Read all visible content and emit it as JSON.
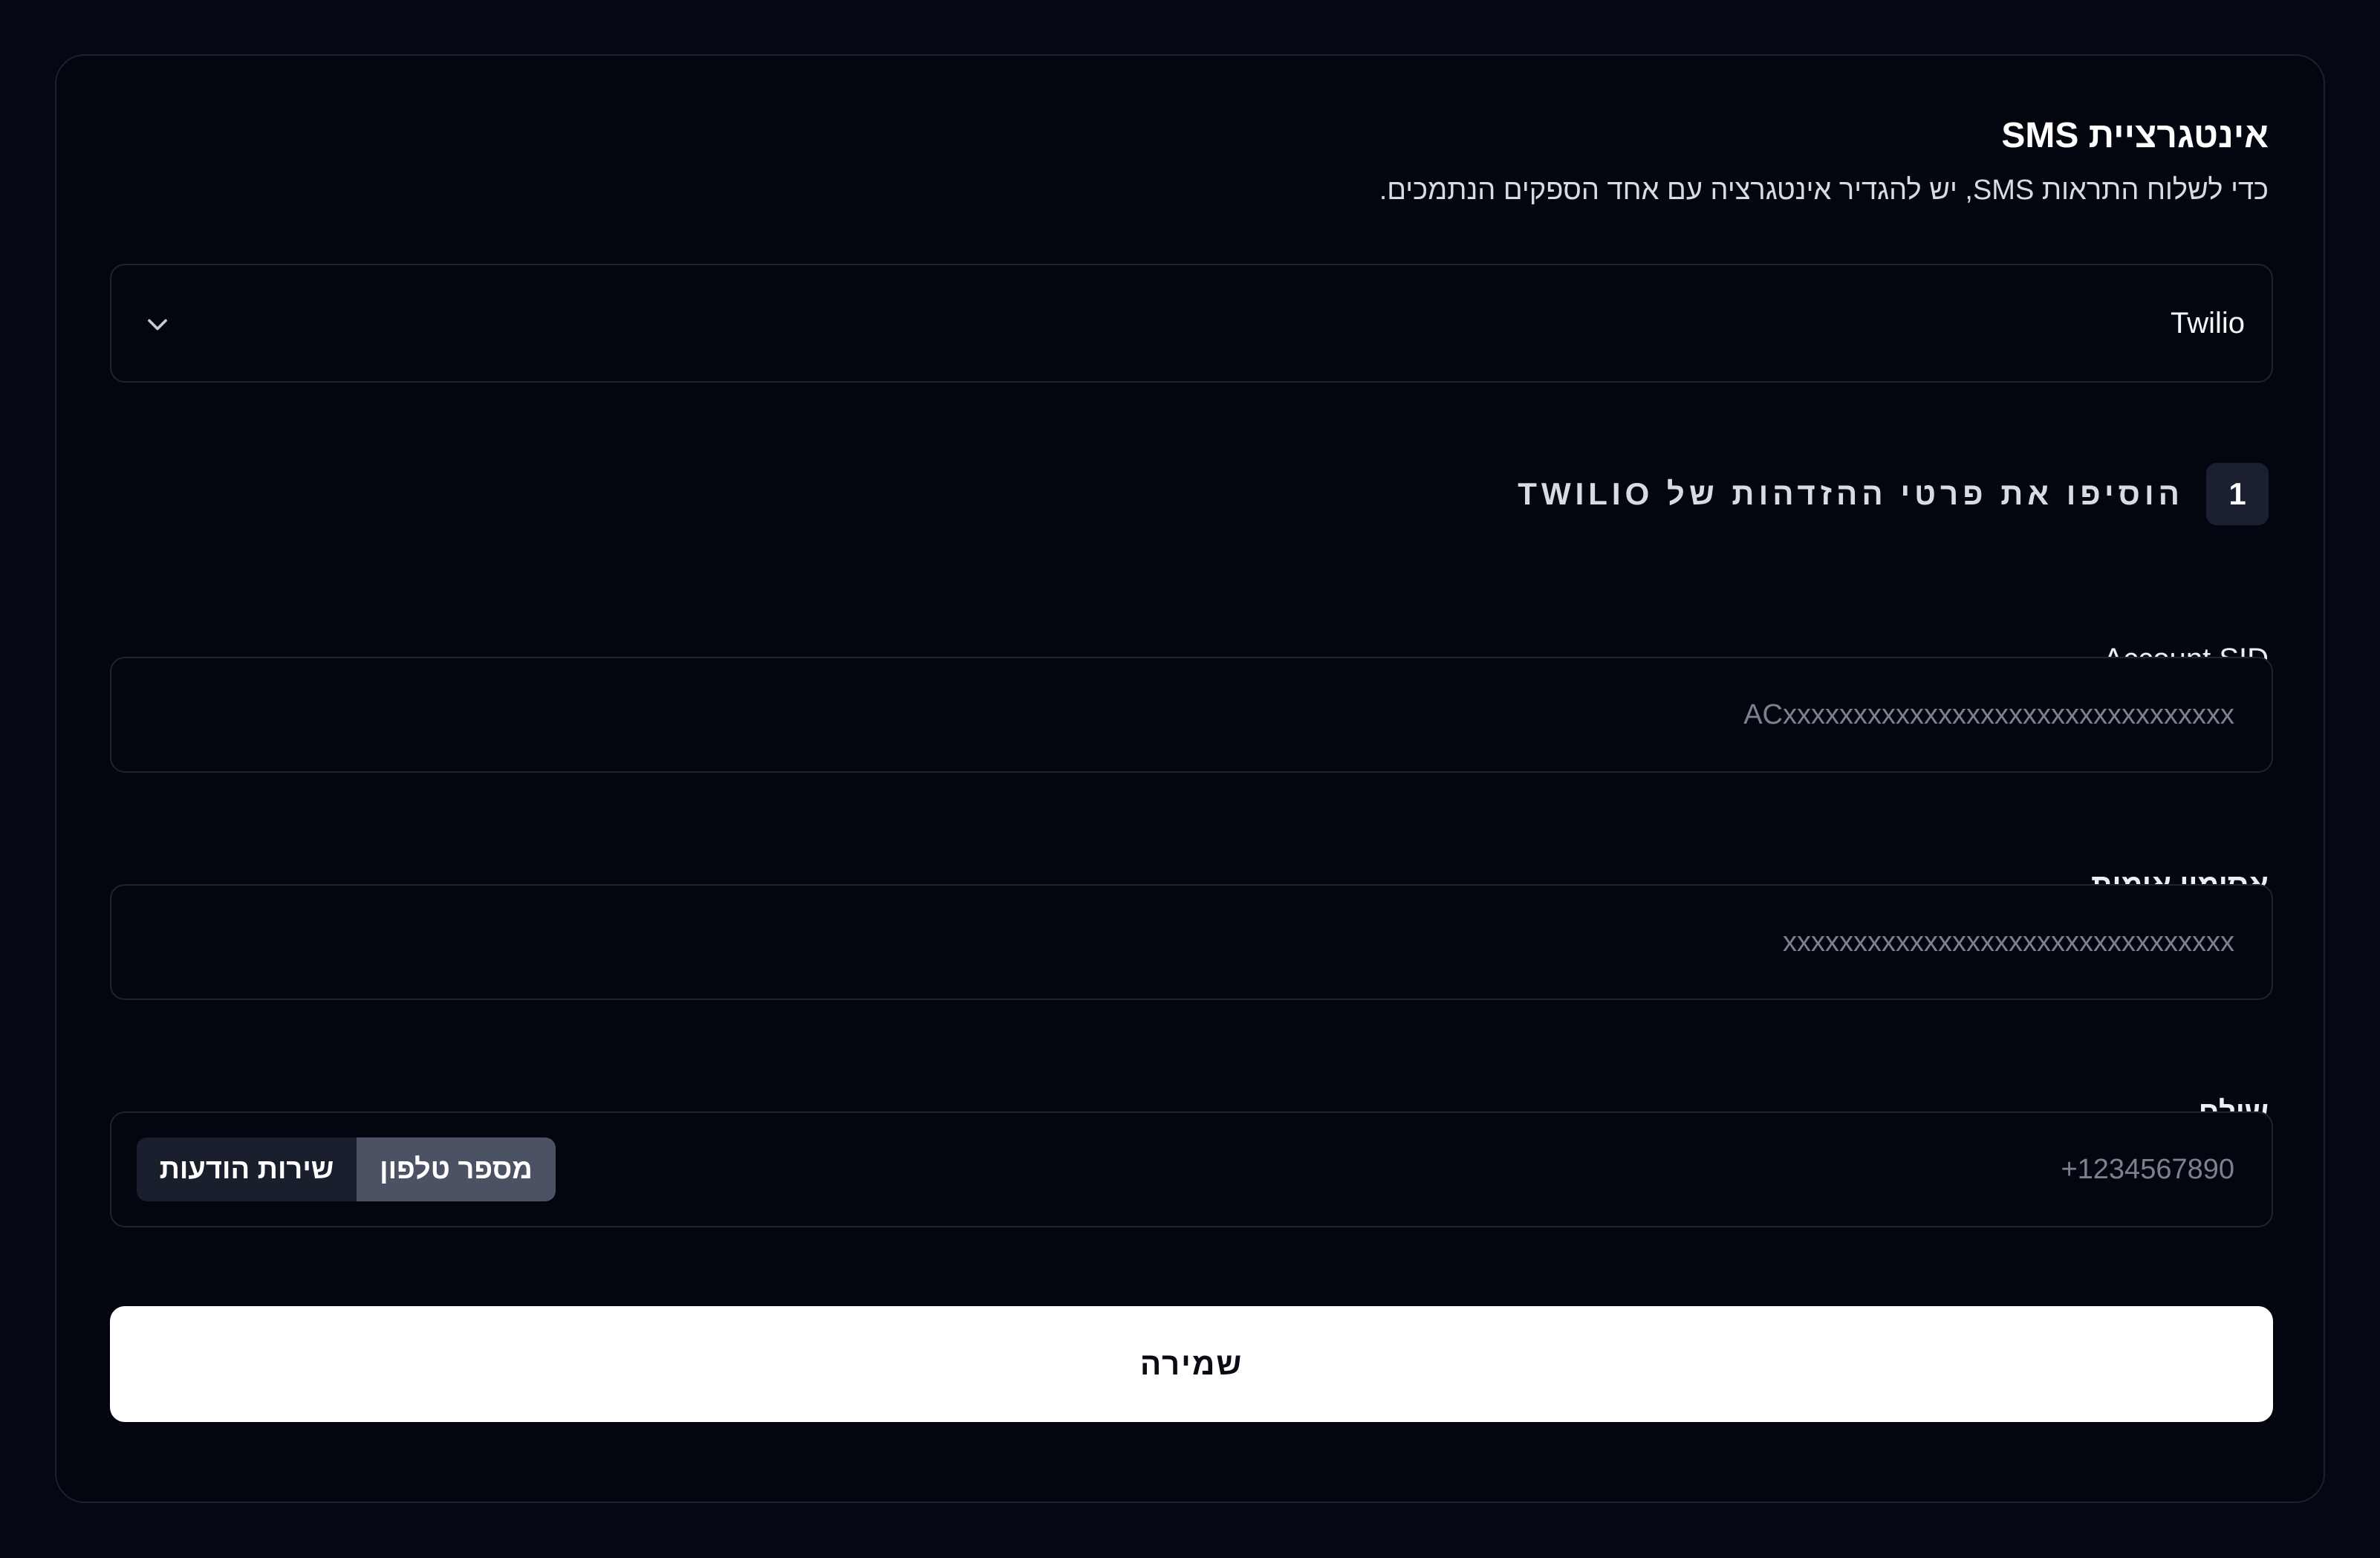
{
  "card": {
    "title": "אינטגרציית SMS",
    "subtitle": "כדי לשלוח התראות SMS, יש להגדיר אינטגרציה עם אחד הספקים הנתמכים."
  },
  "provider_select": {
    "value": "Twilio",
    "icon": "chevron-down-icon"
  },
  "step": {
    "number": "1",
    "label": "הוסיפו את פרטי ההזדהות של TWILIO"
  },
  "fields": {
    "account_sid": {
      "label": "Account SID",
      "placeholder": "ACxxxxxxxxxxxxxxxxxxxxxxxxxxxxxxxx",
      "value": ""
    },
    "auth_token": {
      "label": "אסימון אימות",
      "placeholder": "xxxxxxxxxxxxxxxxxxxxxxxxxxxxxxxx",
      "value": ""
    },
    "sender": {
      "label": "שולח",
      "placeholder": "+1234567890",
      "value": "",
      "toggle": {
        "phone_label": "מספר טלפון",
        "service_label": "שירות הודעות",
        "selected": "phone"
      }
    }
  },
  "save_label": "שמירה",
  "colors": {
    "background": "#050712",
    "border": "#1e2232",
    "toggle_active": "#4b5263",
    "toggle_inactive": "#1a1f2d",
    "save_button": "#ffffff"
  }
}
